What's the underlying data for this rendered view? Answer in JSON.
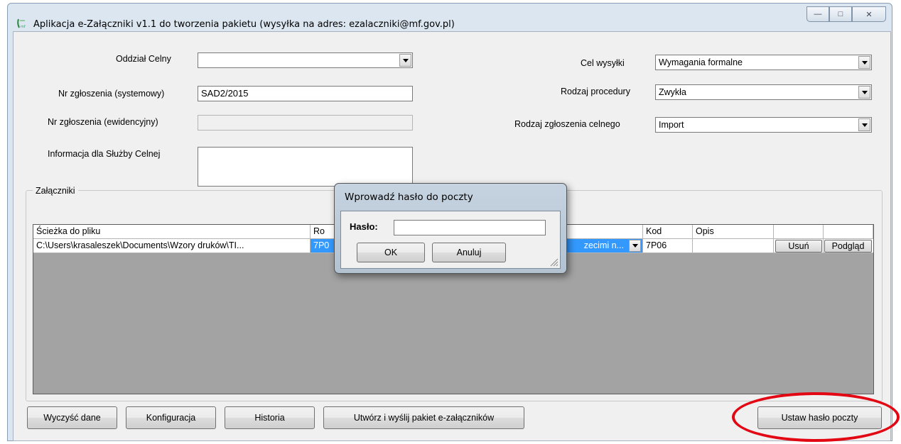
{
  "window": {
    "title": "Aplikacja e-Załączniki v1.1 do tworzenia pakietu (wysyłka na adres: ezalaczniki@mf.gov.pl)",
    "controls": {
      "minimize": "—",
      "maximize": "□",
      "close": "✕"
    }
  },
  "form": {
    "oddzial_celny": {
      "label": "Oddział Celny",
      "value": ""
    },
    "nr_zgloszenia_systemowy": {
      "label": "Nr zgłoszenia (systemowy)",
      "value": "SAD2/2015"
    },
    "nr_zgloszenia_ewidencyjny": {
      "label": "Nr zgłoszenia (ewidencyjny)",
      "value": ""
    },
    "informacja": {
      "label": "Informacja dla Służby Celnej",
      "value": ""
    },
    "cel_wysylki": {
      "label": "Cel wysyłki",
      "value": "Wymagania formalne"
    },
    "rodzaj_procedury": {
      "label": "Rodzaj procedury",
      "value": "Zwykła"
    },
    "rodzaj_zgloszenia": {
      "label": "Rodzaj zgłoszenia celnego",
      "value": "Import"
    }
  },
  "attachments": {
    "group_title": "Załączniki",
    "columns": [
      "Ścieżka do pliku",
      "Ro",
      "Kod",
      "Opis"
    ],
    "rows": [
      {
        "path": "C:\\Users\\krasaleszek\\Documents\\Wzory druków\\TI...",
        "rodzaj_code": "7P0",
        "rodzaj_desc": "zecimi n...",
        "kod": "7P06",
        "opis": "",
        "delete_label": "Usuń",
        "preview_label": "Podgląd"
      }
    ]
  },
  "buttons": {
    "clear": "Wyczyść dane",
    "config": "Konfiguracja",
    "history": "Historia",
    "create_send": "Utwórz i wyślij pakiet e-załączników",
    "set_password": "Ustaw hasło poczty"
  },
  "dialog": {
    "title": "Wprowadź hasło do poczty",
    "password_label": "Hasło:",
    "password_value": "",
    "ok_label": "OK",
    "cancel_label": "Anuluj"
  },
  "colors": {
    "highlight_ellipse": "#e30613",
    "selection": "#3399ff",
    "grid_background": "#a3a3a3"
  }
}
